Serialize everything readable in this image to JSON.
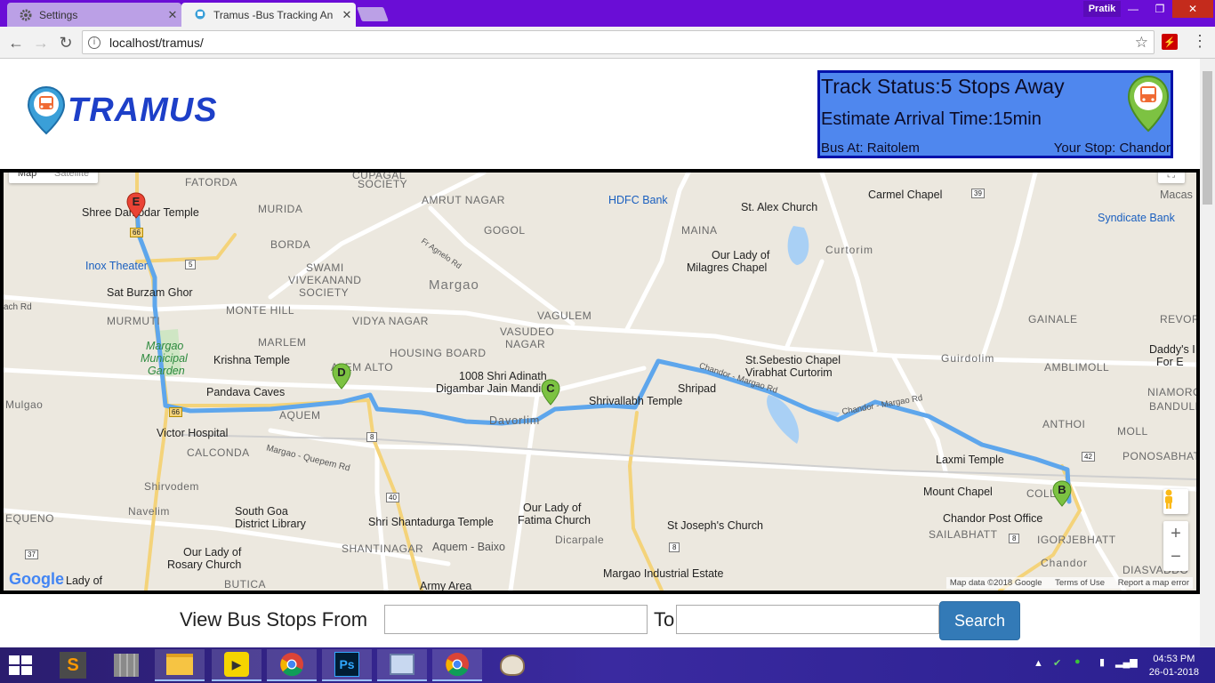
{
  "browser": {
    "tabs": [
      {
        "title": "Settings",
        "icon": "gear-icon",
        "active": false
      },
      {
        "title": "Tramus -Bus Tracking An",
        "icon": "bus-pin-icon",
        "active": true
      }
    ],
    "profile_name": "Pratik",
    "url": "localhost/tramus/"
  },
  "header": {
    "logo_text": "TRAMUS"
  },
  "status": {
    "track_status": "Track Status:5 Stops Away",
    "eta": "Estimate Arrival Time:15min",
    "bus_at": "Bus At: Raitolem",
    "your_stop": "Your Stop: Chandor"
  },
  "map": {
    "map_type_buttons": [
      "Map",
      "Satellite"
    ],
    "markers": [
      "E",
      "D",
      "C",
      "B"
    ],
    "route_color": "#5ea6ec",
    "labels": {
      "fatorda": "FATORDA",
      "cupagal": "CUPAGAL",
      "society1": "SOCIETY",
      "amrut_nagar": "AMRUT NAGAR",
      "hdfc": "HDFC Bank",
      "st_alex": "St. Alex Church",
      "carmel": "Carmel Chapel",
      "macas": "Macas",
      "shree_damodar": "Shree Damodar Temple",
      "murida": "MURIDA",
      "gogol": "GOGOL",
      "fr_agnelo": "Fr Agnelo Rd",
      "maina": "MAINA",
      "curtorim": "Curtorim",
      "syndicate": "Syndicate Bank",
      "borda": "BORDA",
      "inox": "Inox Theater",
      "swami": "SWAMI",
      "vivekanand": "VIVEKANAND",
      "society2": "SOCIETY",
      "margao": "Margao",
      "our_lady_milagres": "Our Lady of",
      "milagres_chapel": "Milagres Chapel",
      "sat_burzam": "Sat Burzam Ghor",
      "ach_rd": "ach Rd",
      "monte_hill": "MONTE HILL",
      "murmuti": "MURMUTI",
      "vidya_nagar": "VIDYA NAGAR",
      "vagulem": "VAGULEM",
      "gainale": "GAINALE",
      "revor": "REVOR",
      "margao_municipal": "Margao",
      "municipal": "Municipal",
      "garden": "Garden",
      "marlem": "MARLEM",
      "vasudeo": "VASUDEO",
      "nagar": "NAGAR",
      "housing_board": "HOUSING BOARD",
      "st_sebestio": "St.Sebestio Chapel",
      "virabhat": "Virabhat Curtorim",
      "guirdolim": "Guirdolim",
      "amblimoll": "AMBLIMOLL",
      "daddys": "Daddy's I",
      "for_e": "For E",
      "krishna_temple": "Krishna Temple",
      "alem_alto": "ALEM ALTO",
      "jain_1": "1008 Shri Adinath",
      "jain_2": "Digambar Jain Mandir",
      "shripad": "Shripad",
      "shrivallabh": "Shrivallabh Temple",
      "chandor_margao_rd_1": "Chandor - Margao Rd",
      "chandor_margao_rd_2": "Chandor - Margao Rd",
      "niamorod": "NIAMOROD",
      "bandull": "BANDULL",
      "mulgao": "Mulgao",
      "pandava": "Pandava Caves",
      "aquem": "AQUEM",
      "davorlim": "Davorlim",
      "anthoi": "ANTHOI",
      "moll": "MOLL",
      "victor": "Victor Hospital",
      "calconda": "CALCONDA",
      "margao_quepem": "Margao - Quepem Rd",
      "laxmi": "Laxmi Temple",
      "ponosabhatt": "PONOSABHATT",
      "shirvodem": "Shirvodem",
      "mount_chapel": "Mount Chapel",
      "coll": "COLL",
      "chandor_po": "Chandor Post Office",
      "equeno": "EQUENO",
      "navelim": "Navelim",
      "south_goa": "South Goa",
      "district_library": "District Library",
      "shantadurga": "Shri Shantadurga Temple",
      "our_lady_fatima": "Our Lady of",
      "fatima_church": "Fatima Church",
      "st_joseph": "St Joseph's Church",
      "sailabhatt": "SAILABHATT",
      "igorjebhatt": "IGORJEBHATT",
      "our_lady_rosary": "Our Lady of",
      "rosary_church": "Rosary Church",
      "shantinagar": "SHANTINAGAR",
      "aquem_baixo": "Aquem - Baixo",
      "dicarpale": "Dicarpale",
      "chandor": "Chandor",
      "diasvaddo": "DIASVADDO",
      "butica": "BUTICA",
      "army_area": "Army Area",
      "margao_ind": "Margao Industrial Estate",
      "lady_of": "Lady of",
      "shield_66a": "66",
      "shield_66b": "66",
      "shield_5": "5",
      "shield_8a": "8",
      "shield_8b": "8",
      "shield_8c": "8",
      "shield_40": "40",
      "shield_39": "39",
      "shield_42": "42",
      "shield_37": "37"
    },
    "google_logo": "Google",
    "attribution": {
      "data": "Map data ©2018 Google",
      "terms": "Terms of Use",
      "report": "Report a map error"
    },
    "zoom_in": "+",
    "zoom_out": "−"
  },
  "search": {
    "from_label": "View Bus Stops From",
    "to_label": "To",
    "button": "Search",
    "from_value": "",
    "to_value": ""
  },
  "taskbar": {
    "apps": [
      "sublime-text-icon",
      "file-manager-icon",
      "file-explorer-icon",
      "media-player-icon",
      "chrome-icon",
      "photoshop-icon",
      "performance-icon",
      "chrome-icon",
      "paint-icon"
    ],
    "time": "04:53 PM",
    "date": "26-01-2018"
  }
}
